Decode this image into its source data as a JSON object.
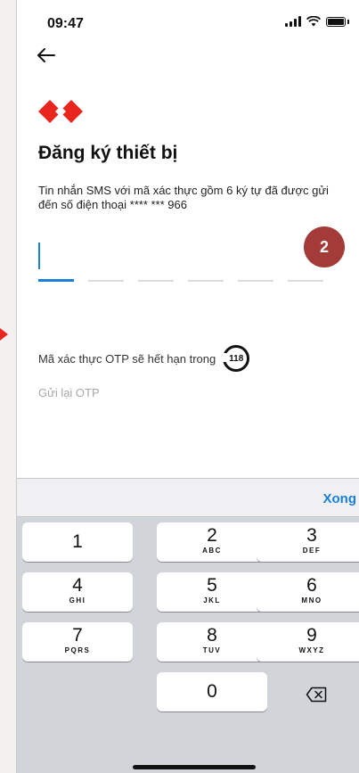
{
  "status_bar": {
    "time": "09:47"
  },
  "header": {
    "title": "Đăng ký thiết bị"
  },
  "message": {
    "text": "Tin nhắn SMS với mã xác thực gồm 6 ký tự đã được gửi đến số điện thoại **** *** 966"
  },
  "step_badge": "2",
  "otp": {
    "slots": 6,
    "active_index": 0
  },
  "expiry": {
    "text": "Mã xác thực OTP sẽ hết hạn trong",
    "seconds": "118"
  },
  "resend_label": "Gửi lại OTP",
  "keyboard": {
    "done_label": "Xong",
    "keys": [
      {
        "num": "1",
        "letters": ""
      },
      {
        "num": "2",
        "letters": "ABC"
      },
      {
        "num": "3",
        "letters": "DEF"
      },
      {
        "num": "4",
        "letters": "GHI"
      },
      {
        "num": "5",
        "letters": "JKL"
      },
      {
        "num": "6",
        "letters": "MNO"
      },
      {
        "num": "7",
        "letters": "PQRS"
      },
      {
        "num": "8",
        "letters": "TUV"
      },
      {
        "num": "9",
        "letters": "WXYZ"
      },
      {
        "num": "0",
        "letters": ""
      }
    ]
  },
  "colors": {
    "accent": "#1a7fd8",
    "brand": "#e8261e",
    "badge": "#a33b39"
  }
}
